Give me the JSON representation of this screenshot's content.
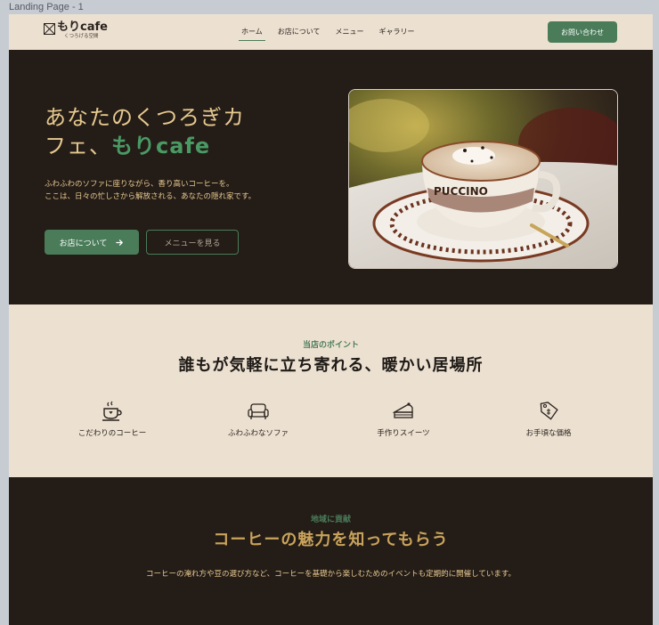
{
  "frame": {
    "label": "Landing Page - 1"
  },
  "header": {
    "logo_title": "もりcafe",
    "logo_sub": "くつろげる空間",
    "nav": [
      "ホーム",
      "お店について",
      "メニュー",
      "ギャラリー"
    ],
    "active_nav": "ホーム",
    "contact_label": "お問い合わせ"
  },
  "hero": {
    "title_line1": "あなたのくつろぎカ",
    "title_line2_prefix": "フェ、",
    "title_accent": "もりcafe",
    "desc_line1": "ふわふわのソファに座りながら、香り高いコーヒーを。",
    "desc_line2": "ここは、日々の忙しさから解放される、あなたの隠れ家です。",
    "primary_button": "お店について",
    "secondary_button": "メニューを見る",
    "image_alt": "cappuccino cup",
    "cup_text": "PUCCINO"
  },
  "features": {
    "eyebrow": "当店のポイント",
    "title": "誰もが気軽に立ち寄れる、暖かい居場所",
    "items": [
      {
        "icon": "coffee-cup-icon",
        "label": "こだわりのコーヒー"
      },
      {
        "icon": "sofa-icon",
        "label": "ふわふわなソファ"
      },
      {
        "icon": "cake-icon",
        "label": "手作りスイーツ"
      },
      {
        "icon": "price-tag-icon",
        "label": "お手頃な価格"
      }
    ]
  },
  "community": {
    "eyebrow": "地域に貢献",
    "title": "コーヒーの魅力を知ってもらう",
    "desc": "コーヒーの淹れ方や豆の選び方など、コーヒーを基礎から楽しむためのイベントも定期的に開催しています。"
  },
  "colors": {
    "accent_green": "#4a7c59",
    "dark_bg": "#241c17",
    "cream_bg": "#ece0d1",
    "gold_text": "#e6c98f"
  }
}
